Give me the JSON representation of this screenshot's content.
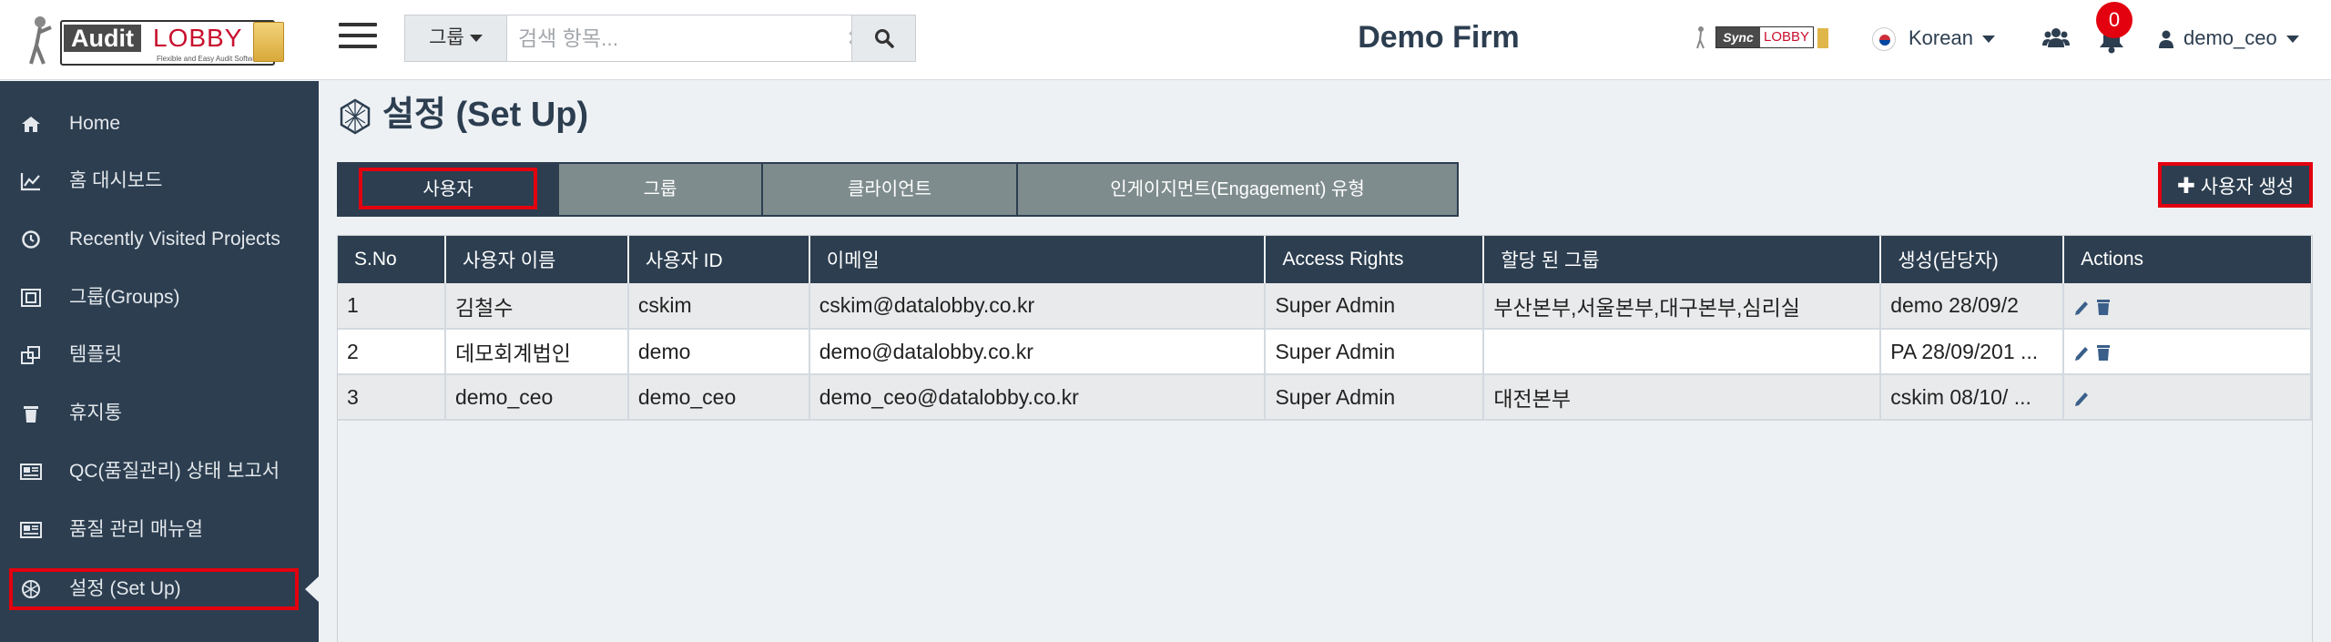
{
  "header": {
    "logo": {
      "audit": "Audit",
      "lobby": "LOBBY",
      "tagline": "Flexible and Easy Audit Software"
    },
    "search": {
      "group_label": "그룹",
      "placeholder": "검색 항목..."
    },
    "firm_name": "Demo Firm",
    "sync_logo": {
      "sync": "Sync",
      "lobby": "LOBBY"
    },
    "language": "Korean",
    "notification_count": "0",
    "username": "demo_ceo"
  },
  "sidebar": {
    "items": [
      {
        "label": "Home",
        "icon": "home-icon"
      },
      {
        "label": "홈 대시보드",
        "icon": "line-chart-icon"
      },
      {
        "label": "Recently Visited Projects",
        "icon": "clock-icon"
      },
      {
        "label": "그룹(Groups)",
        "icon": "groups-icon"
      },
      {
        "label": "템플릿",
        "icon": "template-icon"
      },
      {
        "label": "휴지통",
        "icon": "trash-icon"
      },
      {
        "label": "QC(품질관리) 상태 보고서",
        "icon": "report-icon"
      },
      {
        "label": "품질 관리 매뉴얼",
        "icon": "manual-icon"
      },
      {
        "label": "설정 (Set Up)",
        "icon": "setup-icon"
      }
    ],
    "active_item": "설정 (Set Up)"
  },
  "main": {
    "title": "설정 (Set Up)",
    "tabs": [
      {
        "label": "사용자",
        "active": true
      },
      {
        "label": "그룹",
        "active": false
      },
      {
        "label": "클라이언트",
        "active": false
      },
      {
        "label": "인게이지먼트(Engagement) 유형",
        "active": false
      }
    ],
    "create_button": "사용자 생성",
    "table": {
      "columns": [
        "S.No",
        "사용자 이름",
        "사용자 ID",
        "이메일",
        "Access Rights",
        "할당 된 그룹",
        "생성(담당자)",
        "Actions"
      ],
      "rows": [
        {
          "sno": "1",
          "name": "김철수",
          "id": "cskim",
          "email": "cskim@datalobby.co.kr",
          "rights": "Super Admin",
          "groups": "부산본부,서울본부,대구본부,심리실",
          "created": "demo 28/09/2",
          "actions": [
            "edit",
            "delete"
          ]
        },
        {
          "sno": "2",
          "name": "데모회계법인",
          "id": "demo",
          "email": "demo@datalobby.co.kr",
          "rights": "Super Admin",
          "groups": "",
          "created": "PA 28/09/201 ...",
          "actions": [
            "edit",
            "delete"
          ]
        },
        {
          "sno": "3",
          "name": "demo_ceo",
          "id": "demo_ceo",
          "email": "demo_ceo@datalobby.co.kr",
          "rights": "Super Admin",
          "groups": "대전본부",
          "created": "cskim 08/10/ ...",
          "actions": [
            "edit"
          ]
        }
      ]
    }
  },
  "colors": {
    "sidebar": "#2c3e50",
    "highlight": "#e3000f",
    "tab_inactive": "#7f8c8d",
    "notification": "#e3000f"
  }
}
